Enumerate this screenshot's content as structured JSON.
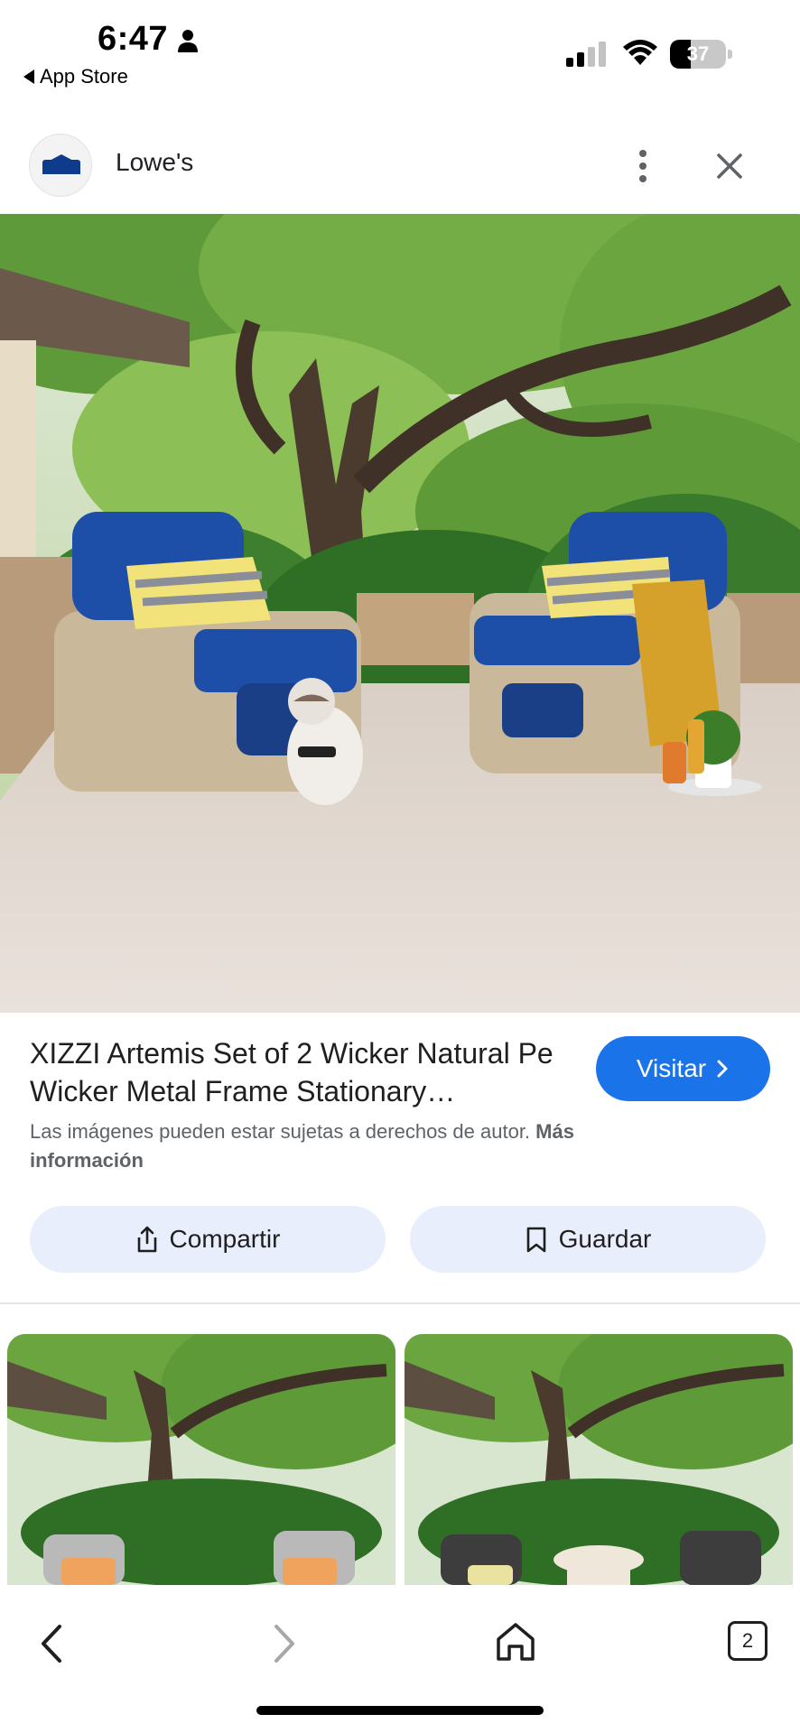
{
  "status_bar": {
    "time": "6:47",
    "back_app_label": "App Store",
    "battery_level": "37",
    "icons": [
      "person-icon",
      "signal-icon",
      "wifi-icon",
      "battery-icon"
    ]
  },
  "header": {
    "site_name": "Lowe's",
    "logo_icon": "lowes-logo-icon",
    "more_icon": "more-vertical-icon",
    "close_icon": "close-icon"
  },
  "hero": {
    "image_subject": "patio-wicker-chairs-photo"
  },
  "product": {
    "title": "XIZZI Artemis Set of 2 Wicker Natural Pe Wicker Metal Frame Stationary…",
    "visit_label": "Visitar",
    "copyright_text": "Las imágenes pueden estar sujetas a derechos de autor. ",
    "copyright_link": "Más información"
  },
  "actions": {
    "share_label": "Compartir",
    "save_label": "Guardar"
  },
  "related": {
    "items": [
      {
        "image_subject": "patio-gray-chairs-photo"
      },
      {
        "image_subject": "patio-dark-chairs-photo"
      }
    ]
  },
  "bottom_nav": {
    "tabs_count": "2",
    "icons": [
      "back-arrow-icon",
      "forward-arrow-icon",
      "home-icon",
      "tabs-icon"
    ]
  },
  "colors": {
    "accent": "#1a73e8",
    "button_bg": "#e8eefb",
    "chair_cushion": "#1e4fa8",
    "wicker": "#c9b99a"
  }
}
